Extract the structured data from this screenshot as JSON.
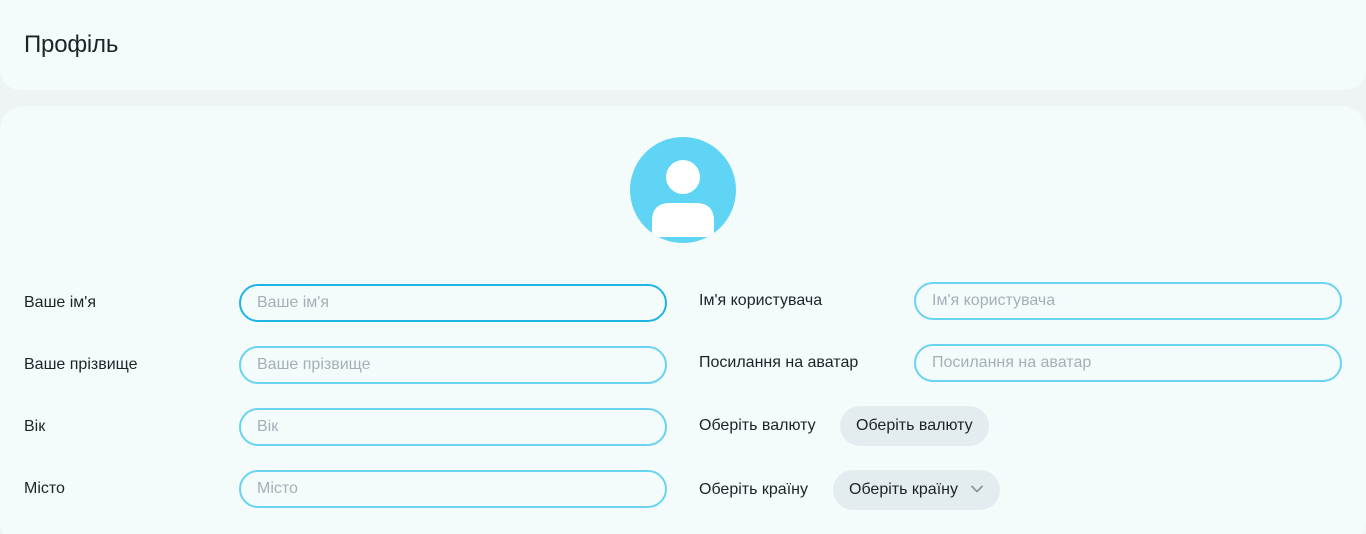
{
  "header": {
    "title": "Профіль"
  },
  "profile": {
    "avatar_icon": "user-avatar-icon",
    "accent_color": "#60d4f4",
    "fields_left": [
      {
        "label": "Ваше ім'я",
        "placeholder": "Ваше ім'я",
        "value": ""
      },
      {
        "label": "Ваше прізвище",
        "placeholder": "Ваше прізвище",
        "value": ""
      },
      {
        "label": "Вік",
        "placeholder": "Вік",
        "value": ""
      },
      {
        "label": "Місто",
        "placeholder": "Місто",
        "value": ""
      }
    ],
    "fields_right": [
      {
        "label": "Ім'я користувача",
        "placeholder": "Ім'я користувача",
        "value": ""
      },
      {
        "label": "Посилання на аватар",
        "placeholder": "Посилання на аватар",
        "value": ""
      }
    ],
    "currency": {
      "label": "Оберіть валюту",
      "button_label": "Оберіть валюту"
    },
    "country": {
      "label": "Оберіть країну",
      "button_label": "Оберіть країну",
      "icon": "chevron-down-icon"
    }
  }
}
